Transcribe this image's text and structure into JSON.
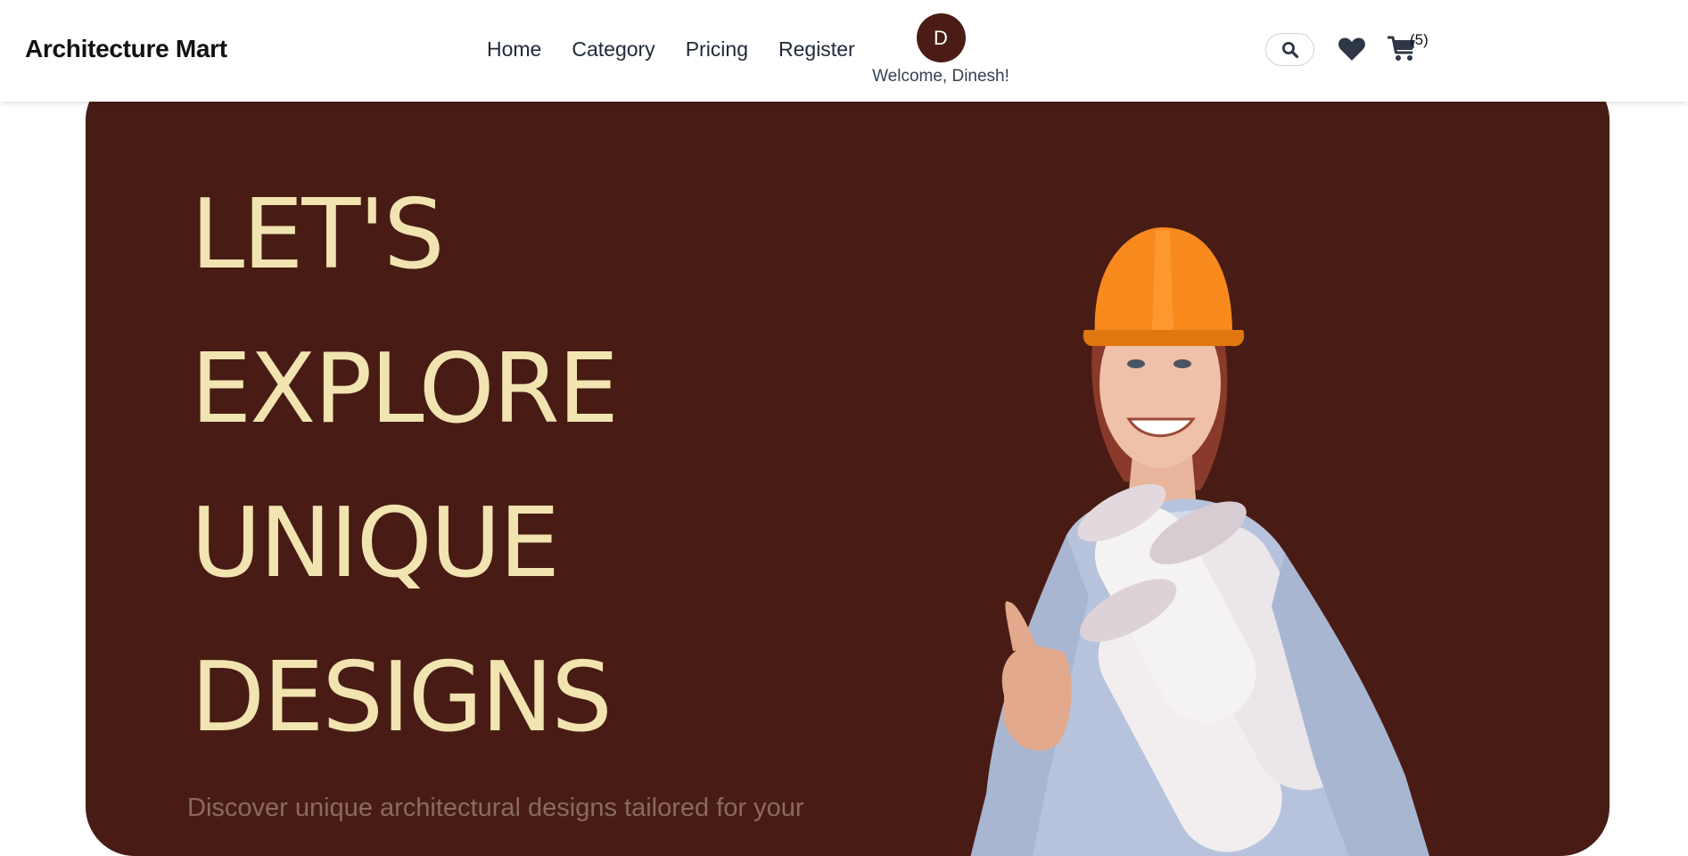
{
  "navbar": {
    "brand": "Architecture Mart",
    "links": [
      {
        "label": "Home"
      },
      {
        "label": "Category"
      },
      {
        "label": "Pricing"
      },
      {
        "label": "Register"
      }
    ],
    "user": {
      "initial": "D",
      "welcome": "Welcome, Dinesh!"
    },
    "actions": {
      "search_icon": "search-icon",
      "wishlist_icon": "heart-icon",
      "cart_icon": "cart-icon",
      "cart_count": "(5)"
    }
  },
  "hero": {
    "lines": [
      "LET'S",
      "EXPLORE",
      "UNIQUE",
      "DESIGNS"
    ],
    "subtitle": "Discover unique architectural designs tailored for your",
    "image": "architect-woman-with-blueprints"
  },
  "colors": {
    "brand_dark": "#481c15",
    "hero_text": "#f1e4b0",
    "nav_text": "#1f2937",
    "helmet": "#f7891d"
  }
}
